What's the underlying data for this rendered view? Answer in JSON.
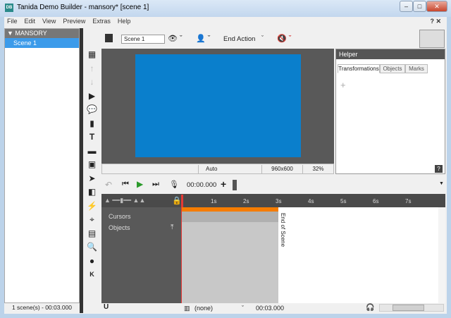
{
  "window": {
    "title": "Tanida Demo Builder - mansory* [scene 1]",
    "app_icon": "DB",
    "controls": [
      "minimize",
      "maximize",
      "close"
    ]
  },
  "menu": {
    "items": [
      "File",
      "Edit",
      "View",
      "Preview",
      "Extras",
      "Help"
    ],
    "right": "? ✕"
  },
  "project": {
    "name": "▼ MANSORY",
    "scenes": [
      "Scene 1"
    ],
    "status": "1 scene(s) - 00:03.000"
  },
  "toolbar": {
    "scene_name": "Scene 1",
    "end_action": "End Action"
  },
  "stage": {
    "canvas_color": "#0a7fcc",
    "auto": "Auto",
    "resolution": "960x600",
    "zoom": "32%"
  },
  "helper": {
    "title": "Helper",
    "tabs": [
      "Transformations",
      "Objects",
      "Marks"
    ],
    "active_tab": "Transformations",
    "add": "+",
    "help": "?"
  },
  "timeline": {
    "time": "00:00.000",
    "ticks": [
      "1s",
      "2s",
      "3s",
      "4s",
      "5s",
      "6s",
      "7s"
    ],
    "tracks": [
      "Cursors",
      "Objects"
    ],
    "end_label": "End of Scene",
    "accent": "#f57c00"
  },
  "bottom": {
    "audio": "(none)",
    "duration": "00:03.000"
  }
}
